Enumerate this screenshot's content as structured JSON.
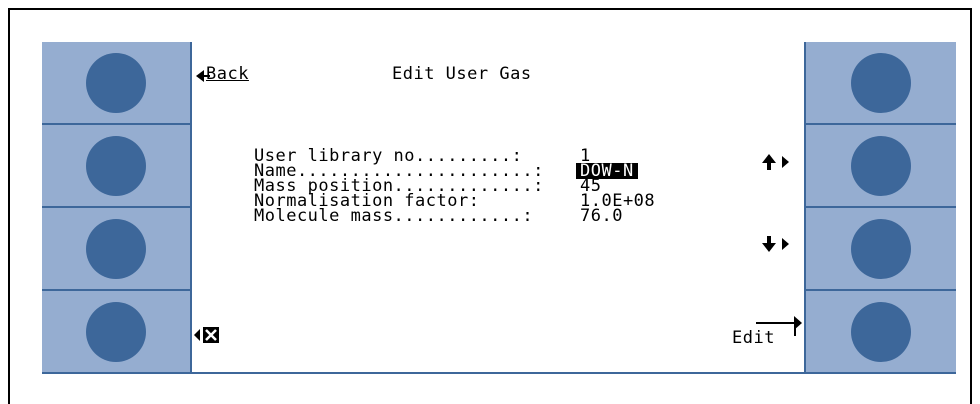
{
  "header": {
    "back_label": "Back",
    "title": "Edit User Gas"
  },
  "fields": [
    {
      "label": "User library no.........:",
      "value": "1"
    },
    {
      "label": "Name......................:",
      "value": "DOW-N"
    },
    {
      "label": "Mass position.............:",
      "value": "45"
    },
    {
      "label": "Normalisation factor:",
      "value": "1.0E+08"
    },
    {
      "label": "Molecule mass............:",
      "value": "76.0"
    }
  ],
  "footer": {
    "edit_label": "Edit"
  },
  "icons": {
    "up": "arrow-up-icon",
    "down": "arrow-down-icon",
    "cancel": "cancel-x-icon"
  },
  "colors": {
    "panel": "#95add0",
    "button": "#3d679a"
  }
}
